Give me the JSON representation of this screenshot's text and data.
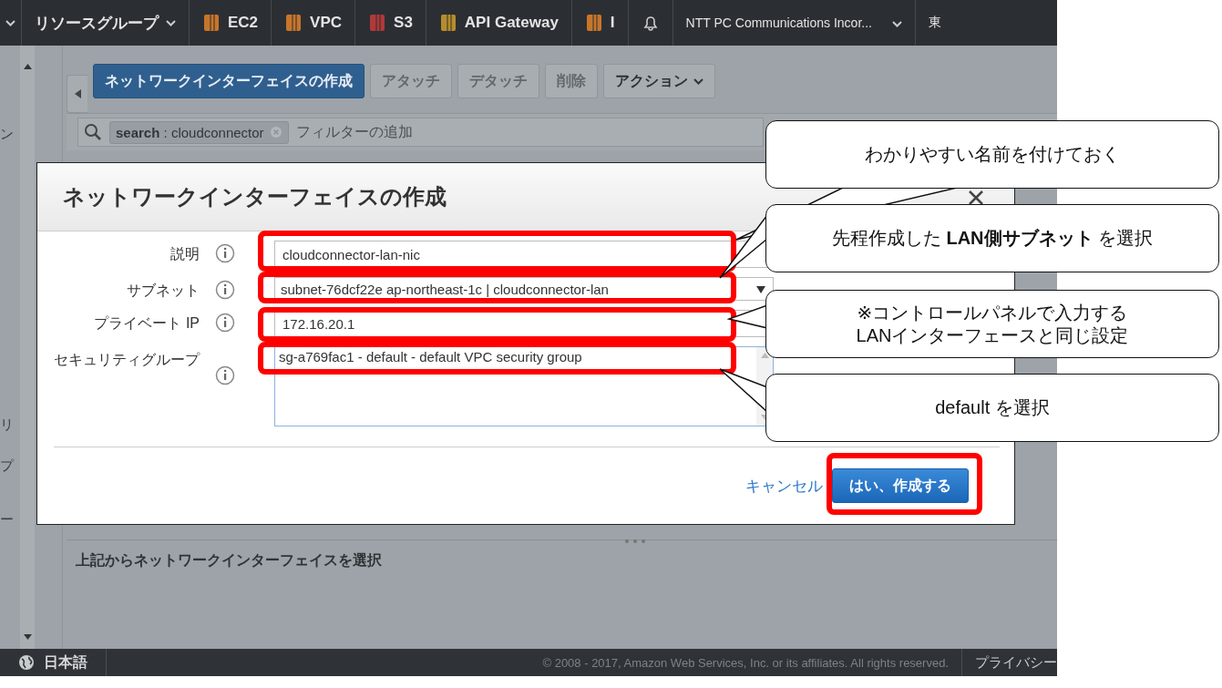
{
  "nav": {
    "items": [
      {
        "label": "リソースグループ",
        "kind": "menu"
      },
      {
        "label": "EC2",
        "kind": "service",
        "color": "#c8752a"
      },
      {
        "label": "VPC",
        "kind": "service",
        "color": "#c8752a"
      },
      {
        "label": "S3",
        "kind": "service",
        "color": "#b0393a"
      },
      {
        "label": "API Gateway",
        "kind": "service",
        "color": "#b58d2a"
      },
      {
        "label": "I",
        "kind": "service",
        "color": "#c8752a"
      }
    ],
    "account": "NTT PC Communications Incor...",
    "region": "東"
  },
  "sidebar": {
    "fragments": [
      "ン",
      "リ",
      "プ",
      "ー"
    ]
  },
  "toolbar": {
    "buttons": [
      {
        "label": "ネットワークインターフェイスの作成",
        "kind": "primary",
        "disabled": false
      },
      {
        "label": "アタッチ",
        "kind": "plain",
        "disabled": true
      },
      {
        "label": "デタッチ",
        "kind": "plain",
        "disabled": true
      },
      {
        "label": "削除",
        "kind": "plain",
        "disabled": true
      },
      {
        "label": "アクション",
        "kind": "dropdown",
        "disabled": false
      }
    ]
  },
  "filter": {
    "token": "**search** : cloudconnector",
    "placeholder": "フィルターの追加"
  },
  "dialog": {
    "title": "ネットワークインターフェイスの作成",
    "fields": [
      {
        "label": "説明",
        "kind": "text",
        "value": "cloudconnector-lan-nic"
      },
      {
        "label": "サブネット",
        "kind": "select",
        "value": "subnet-76dcf22e ap-northeast-1c | cloudconnector-lan"
      },
      {
        "label": "プライベート IP",
        "kind": "text",
        "value": "172.16.20.1"
      },
      {
        "label": "セキュリティグループ",
        "kind": "list",
        "value": "sg-a769fac1 - default - default VPC security group"
      }
    ],
    "cancel": "キャンセル",
    "submit": "はい、作成する"
  },
  "lower_pane": {
    "heading": "上記からネットワークインターフェイスを選択"
  },
  "footer": {
    "language": "日本語",
    "copyright": "© 2008 - 2017, Amazon Web Services, Inc. or its affiliates. All rights reserved.",
    "link": "プライバシー"
  },
  "callouts": [
    {
      "text": "わかりやすい名前を付けておく"
    },
    {
      "text": "先程作成した **LAN側サブネット** を選択"
    },
    {
      "text": "※コントロールパネルで入力する\nLANインターフェースと同じ設定"
    },
    {
      "text": "default を選択"
    }
  ]
}
